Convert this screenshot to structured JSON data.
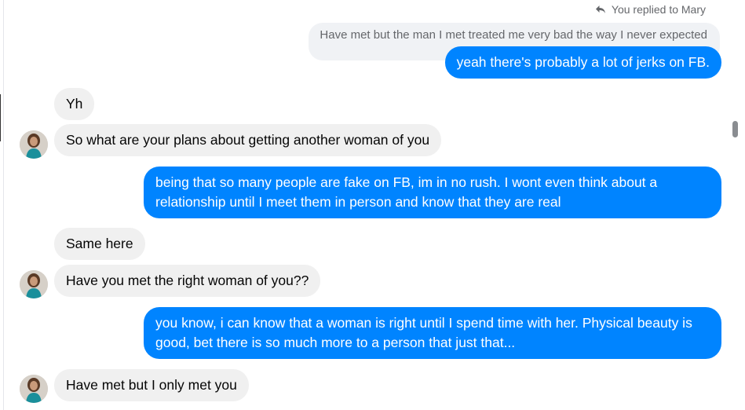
{
  "reply_meta": {
    "text": "You replied to Mary",
    "icon": "reply-arrow-icon"
  },
  "quoted_message": "Have met but the man I met treated me very bad the way I never expected",
  "messages": [
    {
      "direction": "out",
      "text": "yeah there's probably a lot of jerks on FB."
    },
    {
      "direction": "in",
      "text": "Yh",
      "avatar": false
    },
    {
      "direction": "in",
      "text": "So what are your plans about getting another woman of you",
      "avatar": true
    },
    {
      "direction": "out",
      "text": "being that so many people are fake on FB, im in no rush. I wont even think about a relationship until I meet them in person and know that they are real"
    },
    {
      "direction": "in",
      "text": "Same here",
      "avatar": false
    },
    {
      "direction": "in",
      "text": "Have you met the right woman of you??",
      "avatar": true
    },
    {
      "direction": "out",
      "text": "you know, i can know  that a woman is right  until I spend time with her. Physical beauty is good, bet there is so much more to a person that just that..."
    },
    {
      "direction": "in",
      "text": "Have met but I only met you",
      "avatar": true
    }
  ],
  "colors": {
    "outgoing_bubble": "#0084ff",
    "incoming_bubble": "#f0f0f0",
    "quoted_bubble": "#f0f2f5",
    "meta_text": "#65676b"
  }
}
